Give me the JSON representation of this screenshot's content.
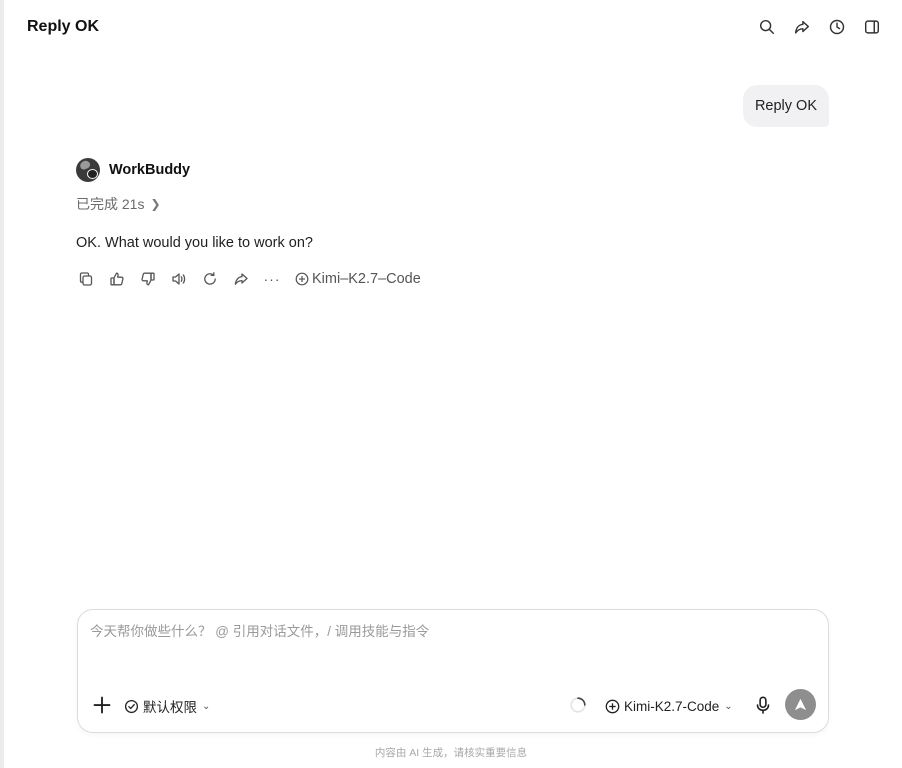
{
  "header": {
    "title": "Reply OK",
    "icons": [
      "search-icon",
      "share-icon",
      "history-icon",
      "sidebar-toggle-icon"
    ]
  },
  "conversation": {
    "user_message": "Reply OK",
    "assistant": {
      "name": "WorkBuddy",
      "status": "已完成 21s",
      "answer": "OK. What would you like to work on?",
      "actions": [
        "copy-icon",
        "thumbs-up-icon",
        "thumbs-down-icon",
        "speaker-icon",
        "regenerate-icon",
        "share-icon",
        "more-icon"
      ],
      "more_label": "···",
      "model": "Kimi–K2.7–Code"
    }
  },
  "composer": {
    "placeholder": "今天帮你做些什么？ @ 引用对话文件，/ 调用技能与指令",
    "permission_label": "默认权限",
    "model_label": "Kimi-K2.7-Code"
  },
  "footer": {
    "disclaimer": "内容由 AI 生成，请核实重要信息"
  },
  "colors": {
    "send_button": "#8e8e8e",
    "user_bubble": "#f1f1f3"
  }
}
